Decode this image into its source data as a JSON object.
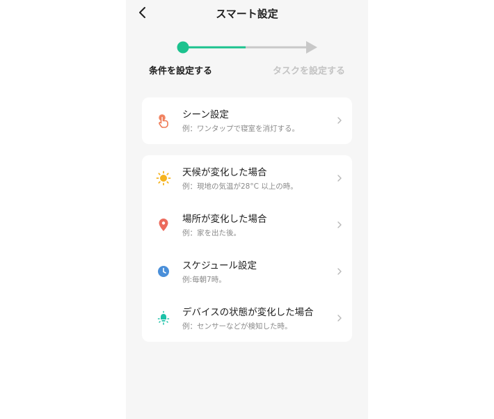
{
  "header": {
    "title": "スマート設定",
    "back_icon": "chevron-left-icon"
  },
  "progress": {
    "steps": [
      {
        "label": "条件を設定する",
        "state": "active"
      },
      {
        "label": "タスクを設定する",
        "state": "inactive"
      }
    ],
    "fraction": 0.5,
    "accent_color": "#1cc28e",
    "inactive_color": "#c8c8c8"
  },
  "scene": {
    "title": "シーン設定",
    "desc": "例：ワンタップで寝室を消灯する。",
    "icon": "tap-hand-icon",
    "icon_color": "#ef7a55"
  },
  "conditions": [
    {
      "title": "天候が変化した場合",
      "desc": "例：現地の気温が28°C 以上の時。",
      "icon": "sun-icon",
      "icon_color": "#f5b31e"
    },
    {
      "title": "場所が変化した場合",
      "desc": "例：家を出た後。",
      "icon": "location-pin-icon",
      "icon_color": "#ec6b5d"
    },
    {
      "title": "スケジュール設定",
      "desc": "例:毎朝7時。",
      "icon": "clock-icon",
      "icon_color": "#4a8fd9"
    },
    {
      "title": "デバイスの状態が変化した場合",
      "desc": "例：センサーなどが検知した時。",
      "icon": "bulb-icon",
      "icon_color": "#1cc2a8"
    }
  ],
  "chevron_icon": "chevron-right-icon"
}
